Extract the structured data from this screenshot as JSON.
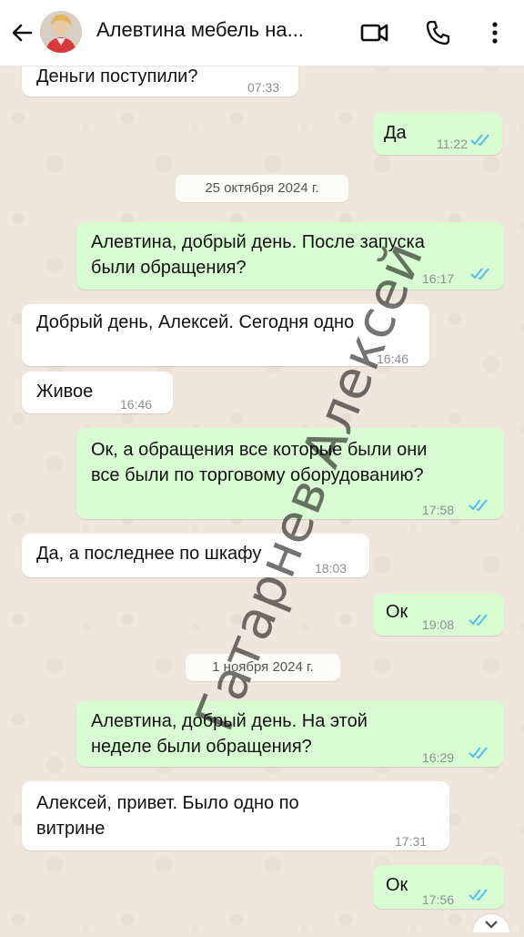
{
  "header": {
    "contact_name": "Алевтина мебель на...",
    "back_icon": "arrow-left-icon",
    "video_icon": "video-call-icon",
    "call_icon": "phone-icon",
    "menu_icon": "more-vertical-icon"
  },
  "messages": [
    {
      "direction": "in",
      "text": "Деньги поступили?",
      "time": "07:33"
    },
    {
      "direction": "out",
      "text": "Да",
      "time": "11:22",
      "read": true
    },
    {
      "type": "date",
      "text": "25 октября 2024 г."
    },
    {
      "direction": "out",
      "lines": [
        "Алевтина, добрый день. После запуска",
        "были обращения?"
      ],
      "time": "16:17",
      "read": true
    },
    {
      "direction": "in",
      "text": "Добрый день, Алексей. Сегодня одно",
      "time": "16:46"
    },
    {
      "direction": "in",
      "text": "Живое",
      "time": "16:46"
    },
    {
      "direction": "out",
      "lines": [
        "Ок, а обращения все которые были они",
        "все были по торговому оборудованию?"
      ],
      "time": "17:58",
      "read": true
    },
    {
      "direction": "in",
      "text": "Да, а последнее по шкафу",
      "time": "18:03"
    },
    {
      "direction": "out",
      "text": "Ок",
      "time": "19:08",
      "read": true
    },
    {
      "type": "date",
      "text": "1 ноября 2024 г."
    },
    {
      "direction": "out",
      "lines": [
        "Алевтина, добрый день. На этой",
        "неделе были обращения?"
      ],
      "time": "16:29",
      "read": true
    },
    {
      "direction": "in",
      "lines": [
        "Алексей, привет. Было одно по",
        "витрине"
      ],
      "time": "17:31"
    },
    {
      "direction": "out",
      "text": "Ок",
      "time": "17:56",
      "read": true
    }
  ],
  "watermark": "Гатарнев Алексей",
  "colors": {
    "incoming_bubble": "#ffffff",
    "outgoing_bubble": "#d9fdd3",
    "read_ticks": "#53bdeb",
    "wallpaper": "#efe7dc"
  }
}
